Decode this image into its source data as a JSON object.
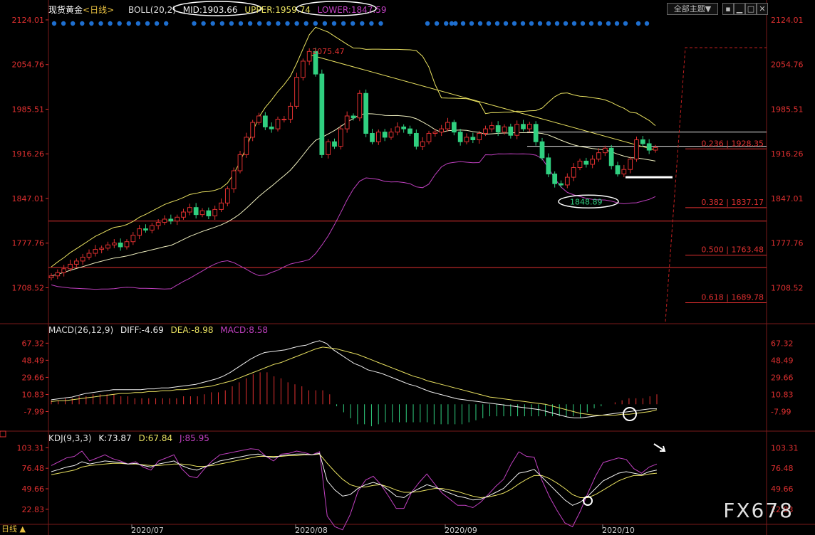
{
  "boll": {
    "instrument": "现货黄金",
    "period_tag": "<日线>",
    "indicator": "BOLL(20,2)",
    "mid": "MID:1903.66",
    "upper": "UPPER:1959.74",
    "lower": "LOWER:1847.59"
  },
  "macd": {
    "name": "MACD(26,12,9)",
    "diff": "DIFF:-4.69",
    "dea": "DEA:-8.98",
    "macd": "MACD:8.58"
  },
  "kdj": {
    "name": "KDJ(9,3,3)",
    "k": "K:73.87",
    "d": "D:67.84",
    "j": "J:85.95"
  },
  "toolbar": {
    "theme_label": "全部主题▼"
  },
  "period_label": "日线 ▲",
  "watermark": "FX678",
  "colors": {
    "up": "#e03030",
    "down": "#30d080",
    "mid": "#f0f0c0",
    "upper": "#e8e060",
    "lower": "#c040c0",
    "fib": "#e03030",
    "dots": "#1e6fd0"
  },
  "chart_data": [
    {
      "type": "candlestick",
      "title": "",
      "yticks": [
        "2124.01",
        "2054.76",
        "1985.51",
        "1916.26",
        "1847.01",
        "1777.76",
        "1708.52"
      ],
      "ylim": [
        1655,
        2135
      ],
      "xticks": [
        "2020/07",
        "2020/08",
        "2020/09",
        "2020/10"
      ],
      "annotations": [
        {
          "text": "2075.47",
          "value": 2075.47
        },
        {
          "text": "1848.89",
          "value": 1848.89
        }
      ],
      "fib_levels": [
        {
          "label": "0.236 | 1928.35",
          "value": 1928.35
        },
        {
          "label": "0.382 | 1837.17",
          "value": 1837.17
        },
        {
          "label": "0.500 | 1763.48",
          "value": 1763.48
        },
        {
          "label": "0.618 | 1689.78",
          "value": 1689.78
        }
      ],
      "h_lines": [
        1950,
        1928,
        1812,
        1740
      ],
      "close": [
        1727,
        1732,
        1738,
        1745,
        1750,
        1756,
        1762,
        1768,
        1770,
        1775,
        1778,
        1772,
        1780,
        1790,
        1800,
        1798,
        1805,
        1810,
        1815,
        1812,
        1818,
        1826,
        1833,
        1822,
        1828,
        1820,
        1830,
        1840,
        1862,
        1890,
        1915,
        1942,
        1965,
        1975,
        1958,
        1955,
        1970,
        1970,
        1990,
        2035,
        2060,
        2075,
        2040,
        1915,
        1935,
        1928,
        1955,
        1975,
        1972,
        2010,
        1948,
        1935,
        1950,
        1942,
        1950,
        1958,
        1955,
        1948,
        1928,
        1935,
        1948,
        1950,
        1955,
        1965,
        1950,
        1935,
        1942,
        1938,
        1948,
        1955,
        1960,
        1950,
        1958,
        1945,
        1962,
        1955,
        1962,
        1935,
        1910,
        1885,
        1870,
        1868,
        1880,
        1895,
        1905,
        1900,
        1908,
        1918,
        1925,
        1898,
        1885,
        1892,
        1908,
        1938,
        1932,
        1922,
        1926
      ]
    },
    {
      "type": "line",
      "title": "MACD",
      "yticks": [
        "67.32",
        "48.49",
        "29.66",
        "10.83",
        "-7.99"
      ],
      "ylim": [
        -28,
        77
      ],
      "series": [
        {
          "name": "DIFF",
          "values": [
            5,
            6,
            7,
            8,
            10,
            12,
            13,
            14,
            15,
            16,
            16,
            16,
            16,
            16,
            17,
            17,
            18,
            18,
            19,
            20,
            21,
            22,
            24,
            26,
            28,
            31,
            35,
            40,
            45,
            50,
            54,
            57,
            58,
            59,
            60,
            62,
            64,
            65,
            68,
            70,
            67,
            60,
            55,
            50,
            45,
            42,
            38,
            36,
            34,
            31,
            28,
            25,
            22,
            20,
            17,
            14,
            12,
            10,
            8,
            6,
            5,
            4,
            3,
            2,
            1,
            0,
            -1,
            -2,
            -3,
            -4,
            -5,
            -6,
            -8,
            -10,
            -12,
            -14,
            -15,
            -15,
            -14,
            -13,
            -12,
            -11,
            -10,
            -9,
            -8,
            -7,
            -6,
            -5,
            -5
          ]
        },
        {
          "name": "DEA",
          "values": [
            3,
            4,
            4,
            5,
            6,
            7,
            8,
            9,
            10,
            11,
            12,
            12,
            13,
            13,
            14,
            14,
            15,
            15,
            16,
            16,
            17,
            18,
            19,
            20,
            22,
            24,
            26,
            29,
            32,
            35,
            38,
            41,
            44,
            46,
            49,
            52,
            55,
            58,
            61,
            63,
            62,
            61,
            59,
            57,
            55,
            52,
            49,
            46,
            43,
            40,
            37,
            34,
            31,
            29,
            26,
            24,
            22,
            20,
            18,
            16,
            14,
            12,
            10,
            8,
            7,
            6,
            5,
            4,
            3,
            2,
            1,
            0,
            -2,
            -4,
            -6,
            -8,
            -10,
            -11,
            -12,
            -12,
            -12,
            -12,
            -11,
            -11,
            -10,
            -9,
            -8,
            -6
          ]
        }
      ],
      "histogram": [
        2,
        2,
        3,
        3,
        4,
        4,
        5,
        5,
        5,
        5,
        4,
        4,
        3,
        3,
        3,
        3,
        3,
        3,
        3,
        4,
        4,
        4,
        5,
        6,
        6,
        7,
        9,
        11,
        13,
        15,
        16,
        16,
        14,
        13,
        11,
        10,
        9,
        7,
        7,
        7,
        5,
        -1,
        -4,
        -7,
        -10,
        -10,
        -11,
        -10,
        -9,
        -9,
        -9,
        -9,
        -9,
        -9,
        -9,
        -10,
        -10,
        -10,
        -10,
        -10,
        -9,
        -8,
        -7,
        -6,
        -6,
        -6,
        -6,
        -6,
        -6,
        -6,
        -6,
        -6,
        -6,
        -6,
        -6,
        -6,
        -7,
        -4,
        -2,
        -1,
        0,
        1,
        2,
        3,
        3,
        3,
        4,
        5
      ]
    },
    {
      "type": "line",
      "title": "KDJ",
      "yticks": [
        "103.31",
        "76.48",
        "49.66",
        "22.83"
      ],
      "ylim": [
        5,
        112
      ],
      "series": [
        {
          "name": "K",
          "values": [
            72,
            75,
            78,
            80,
            85,
            82,
            84,
            86,
            85,
            84,
            82,
            83,
            80,
            78,
            82,
            84,
            86,
            80,
            76,
            74,
            78,
            82,
            86,
            88,
            90,
            92,
            94,
            95,
            92,
            90,
            93,
            94,
            95,
            95,
            94,
            96,
            60,
            48,
            40,
            42,
            50,
            55,
            58,
            55,
            48,
            40,
            38,
            45,
            50,
            55,
            52,
            48,
            44,
            40,
            38,
            35,
            36,
            40,
            45,
            50,
            60,
            70,
            72,
            75,
            65,
            55,
            45,
            35,
            28,
            32,
            40,
            50,
            60,
            65,
            70,
            72,
            70,
            68,
            72,
            74
          ]
        },
        {
          "name": "D",
          "values": [
            68,
            70,
            72,
            74,
            78,
            80,
            81,
            82,
            83,
            83,
            82,
            82,
            81,
            80,
            80,
            81,
            82,
            82,
            81,
            79,
            79,
            80,
            82,
            84,
            86,
            88,
            90,
            92,
            92,
            92,
            92,
            93,
            93,
            94,
            94,
            95,
            83,
            72,
            62,
            55,
            52,
            52,
            54,
            55,
            52,
            48,
            45,
            45,
            46,
            48,
            50,
            50,
            48,
            46,
            43,
            40,
            38,
            39,
            41,
            44,
            49,
            56,
            62,
            67,
            67,
            63,
            57,
            50,
            42,
            38,
            38,
            42,
            48,
            54,
            60,
            64,
            67,
            67,
            69,
            70
          ]
        },
        {
          "name": "J",
          "values": [
            80,
            85,
            90,
            92,
            99,
            86,
            90,
            94,
            89,
            86,
            82,
            85,
            78,
            74,
            86,
            90,
            94,
            76,
            66,
            64,
            76,
            86,
            94,
            96,
            98,
            100,
            102,
            101,
            92,
            86,
            95,
            96,
            99,
            97,
            94,
            98,
            14,
            0,
            -4,
            16,
            46,
            61,
            66,
            55,
            40,
            24,
            24,
            45,
            58,
            69,
            56,
            44,
            36,
            28,
            28,
            25,
            32,
            42,
            53,
            62,
            82,
            98,
            92,
            91,
            61,
            39,
            21,
            5,
            0,
            20,
            44,
            66,
            84,
            87,
            90,
            88,
            76,
            70,
            78,
            82
          ]
        }
      ],
      "xticks": [
        "2020/07",
        "2020/08",
        "2020/09",
        "2020/10"
      ]
    }
  ]
}
